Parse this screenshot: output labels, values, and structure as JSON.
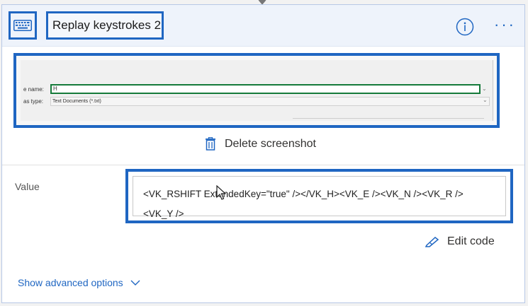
{
  "action": {
    "title": "Replay keystrokes 2"
  },
  "screenshot": {
    "file_name_label": "e name:",
    "file_name_value": "H",
    "save_type_label": "as type:",
    "save_type_value": "Text Documents (*.txt)"
  },
  "delete_screenshot_label": "Delete screenshot",
  "value": {
    "label": "Value",
    "line1": "<VK_RSHIFT ExtendedKey=\"true\" /></VK_H><VK_E /><VK_N /><VK_R />",
    "line2": "<VK_Y />"
  },
  "edit_code_label": "Edit code",
  "show_advanced_label": "Show advanced options",
  "colors": {
    "accent": "#1f66c2",
    "header_bg": "#eef3fb"
  }
}
